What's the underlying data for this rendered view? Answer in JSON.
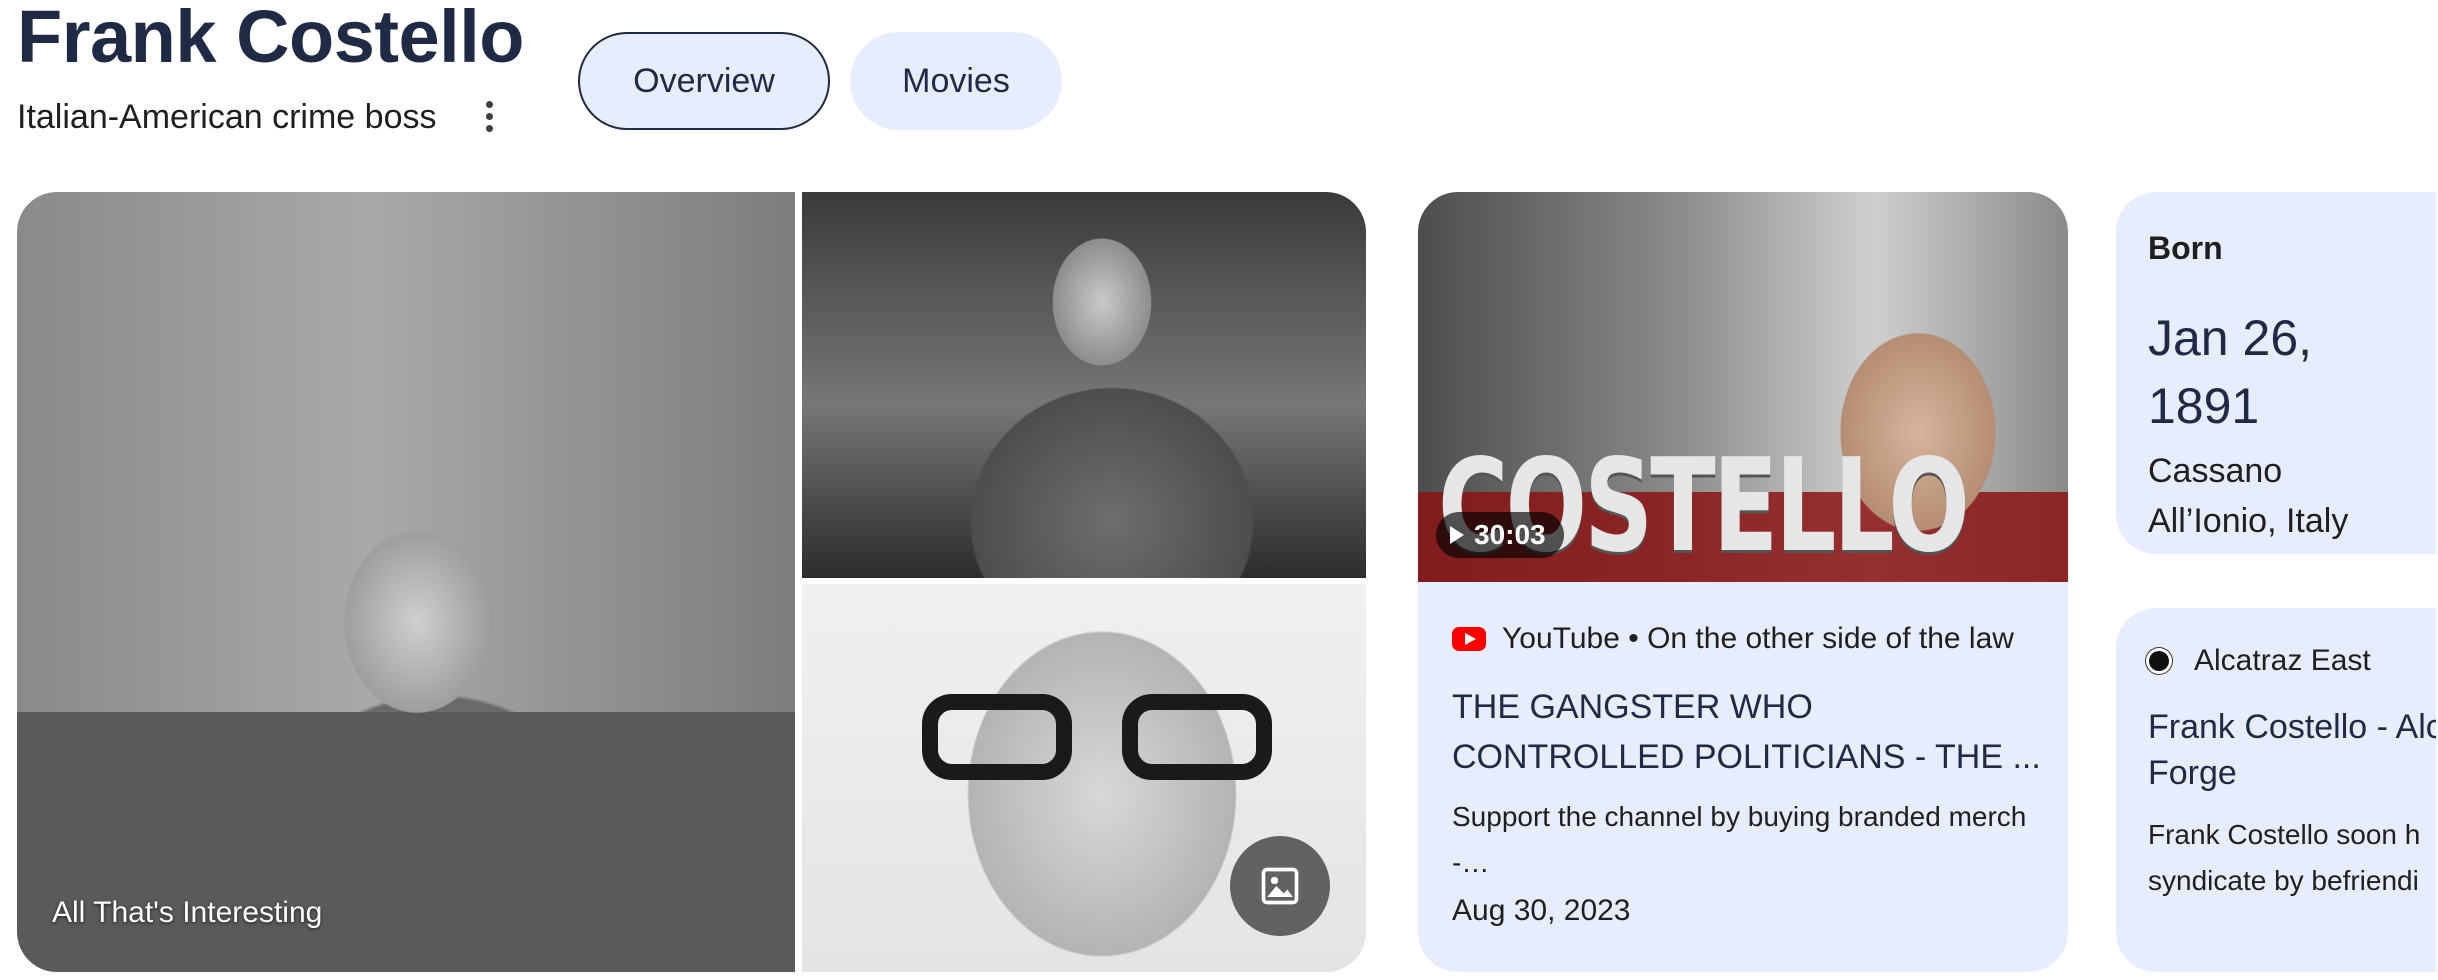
{
  "entity": {
    "name": "Frank Costello",
    "description": "Italian-American crime boss"
  },
  "tabs": [
    {
      "label": "Overview",
      "active": true
    },
    {
      "label": "Movies",
      "active": false
    }
  ],
  "photos": {
    "source": "All That's Interesting"
  },
  "video": {
    "thumbnail_text": "COSTELLO",
    "duration": "30:03",
    "source": "YouTube • On the other side of the law",
    "title": "THE GANGSTER WHO CONTROLLED POLITICIANS - THE ...",
    "description": "Support the channel by buying branded merch -…",
    "date": "Aug 30, 2023"
  },
  "born": {
    "label": "Born",
    "date": "Jan 26, 1891",
    "place": "Cassano All’Ionio, Italy"
  },
  "article": {
    "source": "Alcatraz East",
    "title": "Frank Costello - Alc",
    "title_line2": "Forge",
    "description_line1": "Frank Costello soon h",
    "description_line2": "syndicate by befriendi"
  },
  "colors": {
    "card_bg": "#e8edfd",
    "title_text": "#1f2a44"
  }
}
